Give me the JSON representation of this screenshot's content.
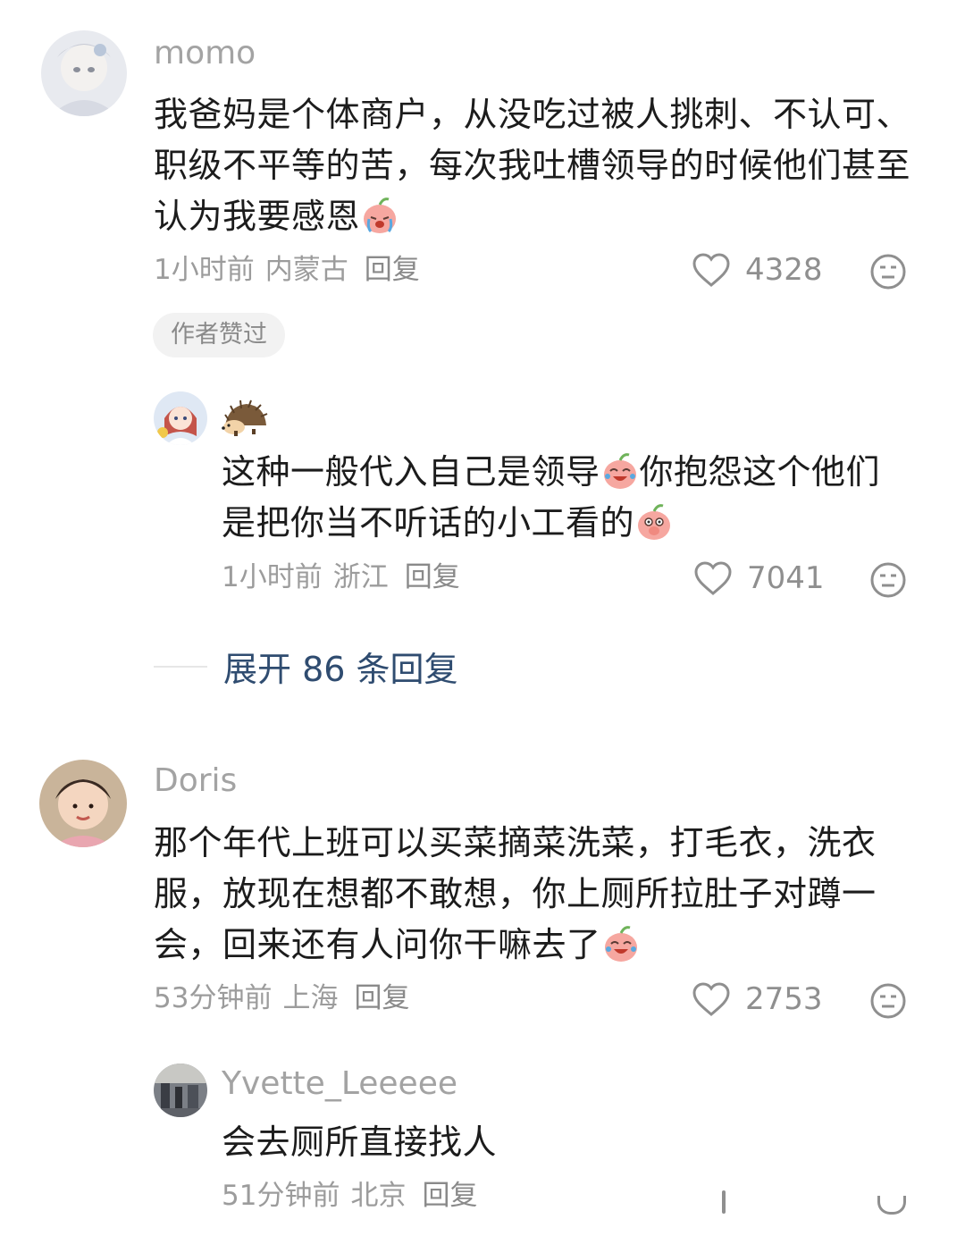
{
  "comments": [
    {
      "username": "momo",
      "text": "我爸妈是个体商户，从没吃过被人挑刺、不认可、职级不平等的苦，每次我吐槽领导的时候他们甚至认为我要感恩",
      "time": "1小时前",
      "location": "内蒙古",
      "reply_label": "回复",
      "likes": "4328",
      "badge": "作者赞过",
      "replies": [
        {
          "username": "",
          "text_part1": "这种一般代入自己是领导",
          "text_part2": "你抱怨这个他们是把你当不听话的小工看的",
          "time": "1小时前",
          "location": "浙江",
          "reply_label": "回复",
          "likes": "7041"
        }
      ],
      "expand_label": "展开 86 条回复"
    },
    {
      "username": "Doris",
      "text": "那个年代上班可以买菜摘菜洗菜，打毛衣，洗衣服，放现在想都不敢想，你上厕所拉肚子对蹲一会，回来还有人问你干嘛去了",
      "time": "53分钟前",
      "location": "上海",
      "reply_label": "回复",
      "likes": "2753",
      "replies": [
        {
          "username": "Yvette_Leeeee",
          "text": "会去厕所直接找人",
          "time": "51分钟前",
          "location": "北京",
          "reply_label": "回复"
        }
      ]
    }
  ],
  "icons": {
    "like": "heart-outline-icon",
    "dislike": "neutral-face-icon",
    "emoji_cry": "crying-peach-emoji",
    "emoji_laugh": "laughing-tears-peach-emoji",
    "emoji_shy": "shy-peach-emoji",
    "hedgehog": "hedgehog-icon"
  },
  "colors": {
    "text": "#1c1c1c",
    "meta": "#9c9c9c",
    "username": "#a3a3a3",
    "expand": "#2f4c70",
    "badge_bg": "#f2f2f2"
  }
}
